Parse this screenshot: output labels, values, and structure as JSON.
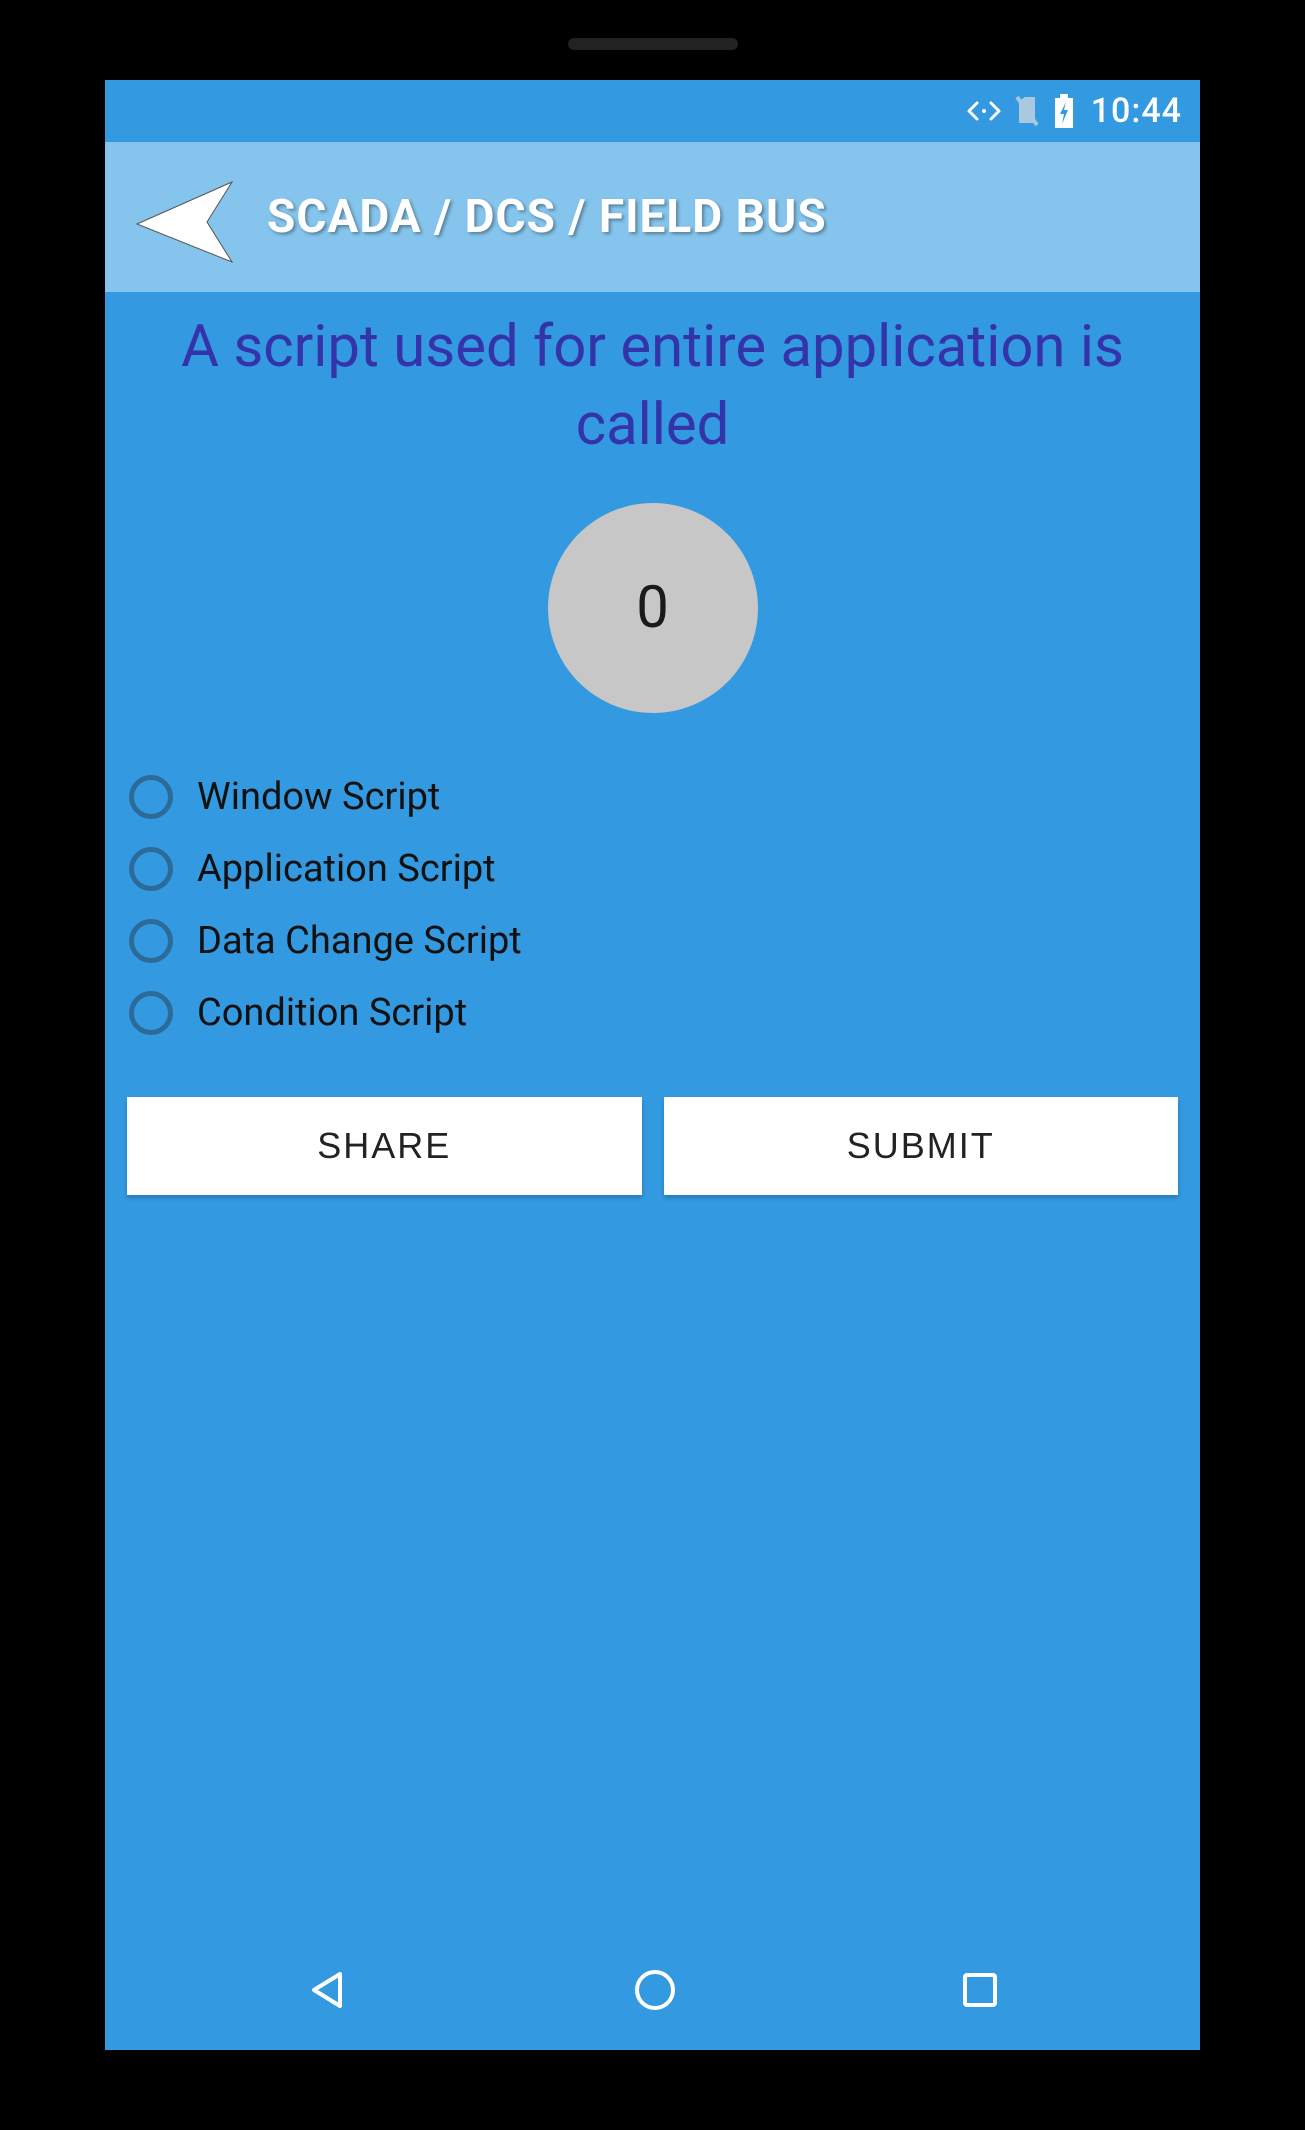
{
  "status": {
    "clock": "10:44"
  },
  "header": {
    "title": "SCADA / DCS / FIELD BUS"
  },
  "question": {
    "text": "A script used for entire application is called",
    "timer": "0"
  },
  "options": [
    {
      "label": "Window Script"
    },
    {
      "label": "Application Script"
    },
    {
      "label": "Data Change Script"
    },
    {
      "label": "Condition Script"
    }
  ],
  "buttons": {
    "share": "SHARE",
    "submit": "SUBMIT"
  }
}
